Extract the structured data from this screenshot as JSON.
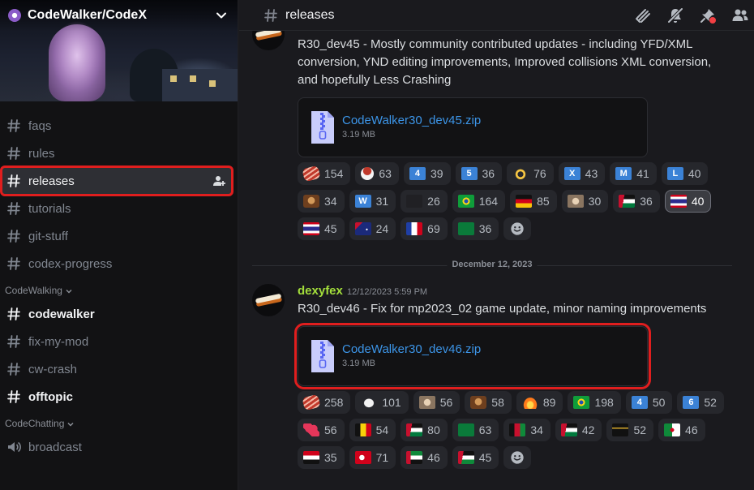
{
  "server": {
    "name": "CodeWalker/CodeX"
  },
  "sidebar": {
    "channels_top": [
      {
        "label": "faqs",
        "state": "normal"
      },
      {
        "label": "rules",
        "state": "normal"
      },
      {
        "label": "releases",
        "state": "selected"
      },
      {
        "label": "tutorials",
        "state": "normal"
      },
      {
        "label": "git-stuff",
        "state": "normal"
      },
      {
        "label": "codex-progress",
        "state": "normal"
      }
    ],
    "category_1": "CodeWalking",
    "channels_cat1": [
      {
        "label": "codewalker",
        "state": "unread"
      },
      {
        "label": "fix-my-mod",
        "state": "normal"
      },
      {
        "label": "cw-crash",
        "state": "normal"
      },
      {
        "label": "offtopic",
        "state": "unread"
      }
    ],
    "category_2": "CodeChatting",
    "channels_cat2": [
      {
        "label": "broadcast",
        "icon": "speaker-icon"
      }
    ]
  },
  "topbar": {
    "channel": "releases",
    "tools": [
      "threads-icon",
      "mute-icon",
      "pin-icon",
      "members-icon"
    ]
  },
  "message1": {
    "text": "R30_dev45 - Mostly community contributed updates - including YFD/XML conversion, YND editing improvements, Improved collisions XML conversion, and hopefully Less Crashing",
    "attachment": {
      "name": "CodeWalker30_dev45.zip",
      "size": "3.19 MB"
    },
    "reactions": [
      {
        "emoji": "bacon",
        "count": "154"
      },
      {
        "emoji": "rice-ball",
        "count": "63"
      },
      {
        "emoji": "keycap-4",
        "count": "39"
      },
      {
        "emoji": "keycap-5",
        "count": "36"
      },
      {
        "emoji": "ok-hand",
        "count": "76"
      },
      {
        "emoji": "letter-x",
        "count": "43"
      },
      {
        "emoji": "letter-m",
        "count": "41"
      },
      {
        "emoji": "letter-l",
        "count": "40"
      },
      {
        "emoji": "face-portrait",
        "count": "34"
      },
      {
        "emoji": "letter-w",
        "count": "31"
      },
      {
        "emoji": "fix-my-mod",
        "count": "26"
      },
      {
        "emoji": "flag-br",
        "count": "164"
      },
      {
        "emoji": "flag-de",
        "count": "85"
      },
      {
        "emoji": "photo-face",
        "count": "30"
      },
      {
        "emoji": "flag-jo",
        "count": "36"
      },
      {
        "emoji": "flag-th",
        "count": "40",
        "me": true
      },
      {
        "emoji": "flag-th",
        "count": "45"
      },
      {
        "emoji": "flag-au",
        "count": "24"
      },
      {
        "emoji": "flag-fr",
        "count": "69"
      },
      {
        "emoji": "flag-sa",
        "count": "36"
      }
    ]
  },
  "divider": {
    "date": "December 12, 2023"
  },
  "message2": {
    "username": "dexyfex",
    "timestamp": "12/12/2023 5:59 PM",
    "text": "R30_dev46 - Fix for mp2023_02 game update, minor naming improvements",
    "attachment": {
      "name": "CodeWalker30_dev46.zip",
      "size": "3.19 MB"
    },
    "reactions": [
      {
        "emoji": "bacon",
        "count": "258"
      },
      {
        "emoji": "goat",
        "count": "101"
      },
      {
        "emoji": "photo-face",
        "count": "56"
      },
      {
        "emoji": "face-portrait",
        "count": "58"
      },
      {
        "emoji": "fire",
        "count": "89"
      },
      {
        "emoji": "flag-br",
        "count": "198"
      },
      {
        "emoji": "keycap-4",
        "count": "50"
      },
      {
        "emoji": "keycap-6",
        "count": "52"
      },
      {
        "emoji": "heart-exclamation",
        "count": "56"
      },
      {
        "emoji": "flag-be",
        "count": "54"
      },
      {
        "emoji": "flag-ps",
        "count": "80"
      },
      {
        "emoji": "flag-sa",
        "count": "63"
      },
      {
        "emoji": "flag-af",
        "count": "34"
      },
      {
        "emoji": "flag-jo",
        "count": "42"
      },
      {
        "emoji": "kaaba",
        "count": "52"
      },
      {
        "emoji": "flag-dz",
        "count": "46"
      },
      {
        "emoji": "flag-sy",
        "count": "35"
      },
      {
        "emoji": "flag-tr",
        "count": "71"
      },
      {
        "emoji": "flag-ae",
        "count": "46"
      },
      {
        "emoji": "flag-eh",
        "count": "45"
      }
    ]
  },
  "colors": {
    "accent_link": "#3c95e8",
    "username": "#a3de3b",
    "highlight": "#e01e1e",
    "bg": "#1a1a1e",
    "sidebar_bg": "#121214"
  }
}
